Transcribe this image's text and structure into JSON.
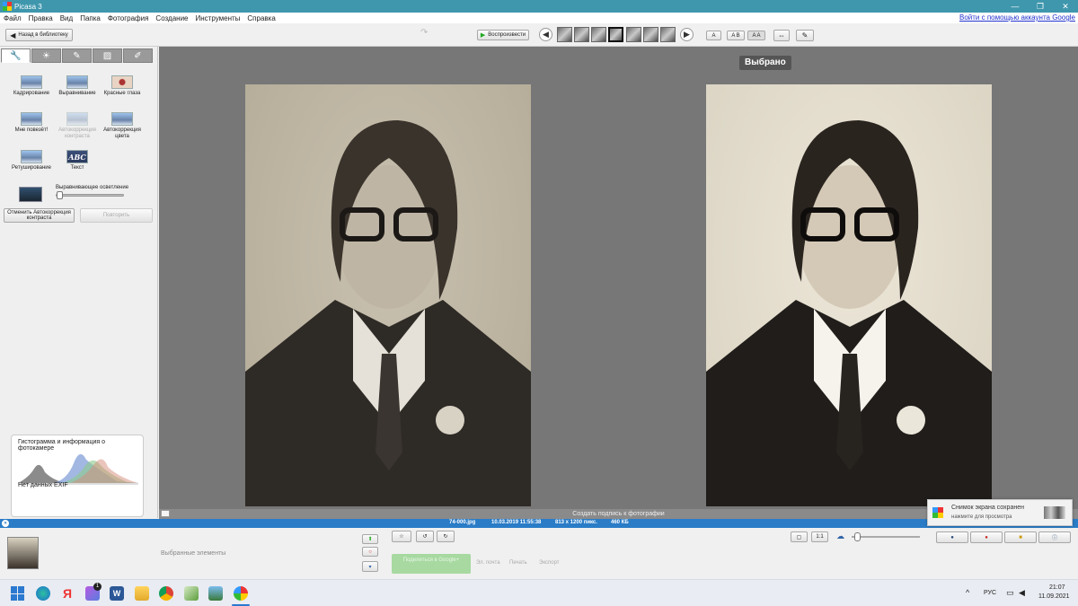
{
  "window": {
    "title": "Picasa 3",
    "minimize": "—",
    "restore": "❐",
    "close": "✕"
  },
  "menu": {
    "items": [
      "Файл",
      "Правка",
      "Вид",
      "Папка",
      "Фотография",
      "Создание",
      "Инструменты",
      "Справка"
    ],
    "google_link": "Войти с помощью аккаунта Google"
  },
  "toolbar": {
    "back_label": "Назад в библиотеку",
    "play_label": "Воспроизвести",
    "layout_single": "A",
    "layout_double": "A B",
    "layout_compare": "A A"
  },
  "tabs": [
    "wrench-icon",
    "sun-icon",
    "brush-icon",
    "effects-icon",
    "paint-icon"
  ],
  "tools": {
    "crop": "Кадрирование",
    "straighten": "Выравнивание",
    "redeye": "Красные глаза",
    "lucky": "Мне повезёт!",
    "autocontrast": "Автокоррекция контраста",
    "autocolor": "Автокоррекция цвета",
    "retouch": "Ретуширование",
    "text": "Текст",
    "text_icon_label": "ABC",
    "filllight": "Выравнивающее осветление",
    "undo": "Отменить Автокоррекция контраста",
    "redo": "Повторить"
  },
  "histogram": {
    "title": "Гистограмма и информация о фотокамере",
    "exif": "Нет данных EXIF"
  },
  "viewer": {
    "selected_tooltip": "Выбрано",
    "caption_placeholder": "Создать подпись к фотографии"
  },
  "info": {
    "filename": "74-000.jpg",
    "date": "10.03.2019 11:55:38",
    "size": "813 x 1200 пикс.",
    "filesize": "460 КБ"
  },
  "tray": {
    "selected_items": "Выбранные элементы",
    "share": "Поделиться в Google+",
    "email": "Эл. почта",
    "print": "Печать",
    "export": "Экспорт"
  },
  "notification": {
    "title": "Снимок экрана сохранен",
    "subtitle": "нажмите для просмотра"
  },
  "taskbar": {
    "lang": "РУС",
    "time": "21:07",
    "date": "11.09.2021",
    "badge": "1"
  }
}
